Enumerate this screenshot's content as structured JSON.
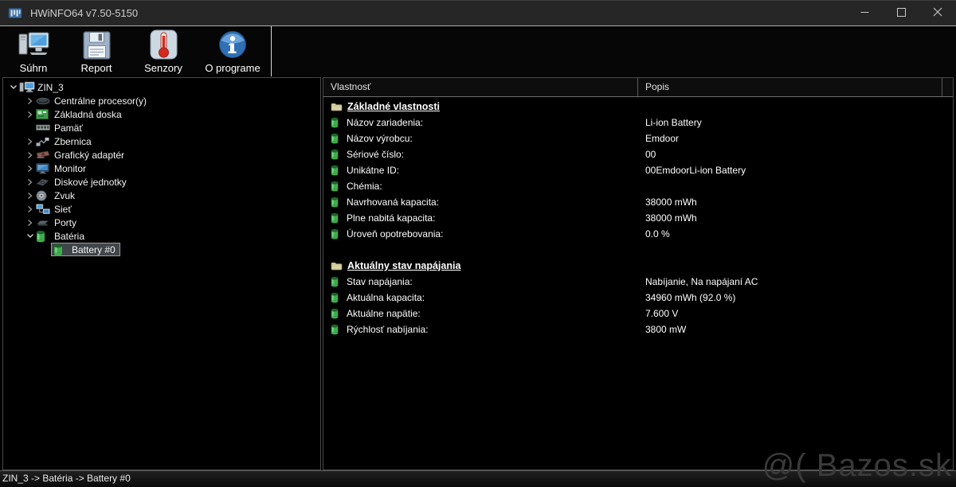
{
  "titlebar": {
    "title": "HWiNFO64 v7.50-5150"
  },
  "toolbar": {
    "buttons": [
      {
        "id": "summary",
        "label": "Súhrn",
        "icon": "computer-summary-icon"
      },
      {
        "id": "report",
        "label": "Report",
        "icon": "floppy-report-icon"
      },
      {
        "id": "sensors",
        "label": "Senzory",
        "icon": "thermometer-sensors-icon"
      },
      {
        "id": "about",
        "label": "O programe",
        "icon": "info-about-icon"
      }
    ]
  },
  "tree": {
    "items": [
      {
        "label": "ZIN_3",
        "level": 0,
        "expand": "expanded",
        "icon": "computer-icon",
        "selected": false
      },
      {
        "label": "Centrálne procesor(y)",
        "level": 1,
        "expand": "collapsed",
        "icon": "cpu-icon",
        "selected": false
      },
      {
        "label": "Základná doska",
        "level": 1,
        "expand": "collapsed",
        "icon": "motherboard-icon",
        "selected": false
      },
      {
        "label": "Pamäť",
        "level": 1,
        "expand": "none",
        "icon": "memory-icon",
        "selected": false
      },
      {
        "label": "Zbernica",
        "level": 1,
        "expand": "collapsed",
        "icon": "bus-icon",
        "selected": false
      },
      {
        "label": "Grafický adaptér",
        "level": 1,
        "expand": "collapsed",
        "icon": "gpu-icon",
        "selected": false
      },
      {
        "label": "Monitor",
        "level": 1,
        "expand": "collapsed",
        "icon": "monitor-icon",
        "selected": false
      },
      {
        "label": "Diskové jednotky",
        "level": 1,
        "expand": "collapsed",
        "icon": "disk-icon",
        "selected": false
      },
      {
        "label": "Zvuk",
        "level": 1,
        "expand": "collapsed",
        "icon": "audio-icon",
        "selected": false
      },
      {
        "label": "Sieť",
        "level": 1,
        "expand": "collapsed",
        "icon": "network-icon",
        "selected": false
      },
      {
        "label": "Porty",
        "level": 1,
        "expand": "collapsed",
        "icon": "ports-icon",
        "selected": false
      },
      {
        "label": "Batéria",
        "level": 1,
        "expand": "expanded",
        "icon": "battery-icon",
        "selected": false
      },
      {
        "label": "Battery #0",
        "level": 2,
        "expand": "none",
        "icon": "battery-icon",
        "selected": true
      }
    ]
  },
  "details": {
    "columns": {
      "property": "Vlastnosť",
      "description": "Popis"
    },
    "sections": [
      {
        "title": "Základné vlastnosti",
        "icon": "folder-icon",
        "rows": [
          {
            "label": "Názov zariadenia:",
            "value": "Li-ion Battery"
          },
          {
            "label": "Názov výrobcu:",
            "value": "Emdoor"
          },
          {
            "label": "Sériové číslo:",
            "value": "00"
          },
          {
            "label": "Unikátne ID:",
            "value": "00EmdoorLi-ion Battery"
          },
          {
            "label": "Chémia:",
            "value": ""
          },
          {
            "label": "Navrhovaná kapacita:",
            "value": "38000 mWh"
          },
          {
            "label": "Plne nabitá kapacita:",
            "value": "38000 mWh"
          },
          {
            "label": "Úroveň opotrebovania:",
            "value": "0.0 %"
          }
        ]
      },
      {
        "title": "Aktuálny stav napájania",
        "icon": "folder-icon",
        "rows": [
          {
            "label": "Stav napájania:",
            "value": "Nabíjanie, Na napájaní AC"
          },
          {
            "label": "Aktuálna kapacita:",
            "value": "34960 mWh (92.0 %)"
          },
          {
            "label": "Aktuálne napätie:",
            "value": "7.600 V"
          },
          {
            "label": "Rýchlosť nabíjania:",
            "value": "3800 mW"
          }
        ]
      }
    ]
  },
  "statusbar": {
    "path": "ZIN_3 -> Batéria -> Battery #0"
  },
  "watermark": {
    "text": "@( Bazos.sk"
  },
  "colors": {
    "battery_green": "#3fae4e",
    "folder_tan": "#d9d3a4",
    "selection_bg": "#40454a",
    "selection_border": "#979ea5",
    "titlebar_bg": "#262626",
    "panel_border": "#4a4a4a"
  }
}
